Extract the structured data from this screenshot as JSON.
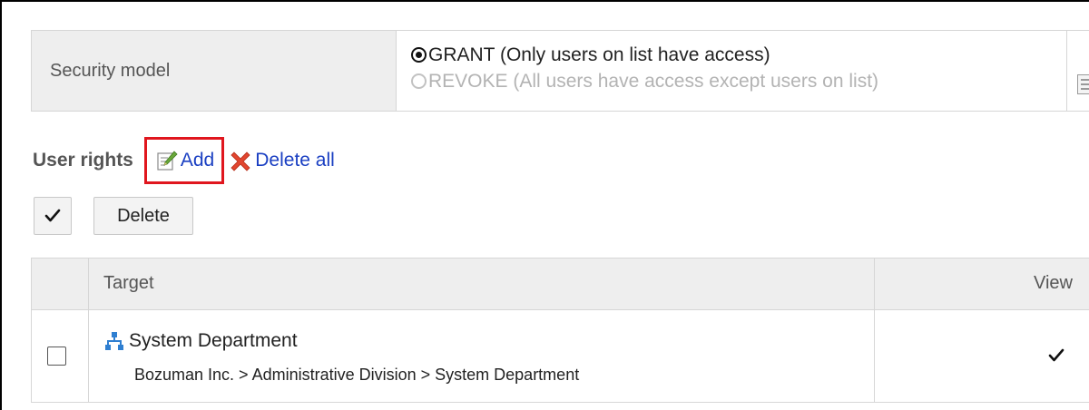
{
  "security": {
    "label": "Security model",
    "options": [
      {
        "label": "GRANT (Only users on list have access)",
        "selected": true
      },
      {
        "label": "REVOKE (All users have access except users on list)",
        "selected": false
      }
    ]
  },
  "user_rights": {
    "title": "User rights",
    "add_label": "Add",
    "delete_all_label": "Delete all"
  },
  "toolbar": {
    "select_all_symbol": "✔",
    "delete_label": "Delete"
  },
  "table": {
    "headers": [
      "Target",
      "View"
    ],
    "rows": [
      {
        "name": "System Department",
        "path": "Bozuman Inc. > Administrative Division > System Department",
        "view_mark": "✔",
        "checked": false
      }
    ]
  },
  "colors": {
    "link": "#1a3fc2",
    "highlight": "#e0161e",
    "header_bg": "#eeeeee",
    "border": "#d6d6d6"
  }
}
